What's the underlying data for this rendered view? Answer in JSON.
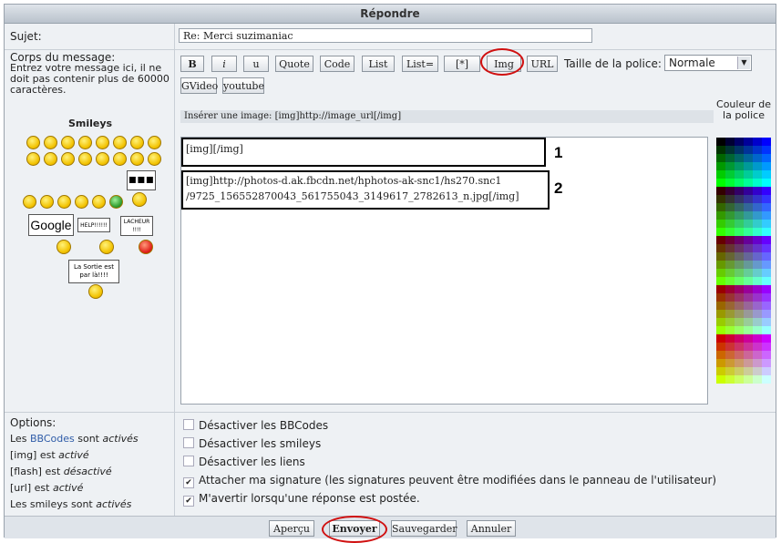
{
  "window": {
    "title": "Répondre"
  },
  "subject": {
    "label": "Sujet:",
    "value": "Re: Merci suzimaniac"
  },
  "message": {
    "label": "Corps du message:",
    "help": "Entrez votre message ici, il ne doit pas contenir plus de 60000 caractères."
  },
  "smileys": {
    "title": "Smileys",
    "signs": [
      "Google",
      "HELP!!!!!!",
      "LACHEUR !!!!",
      "La Sortie est par là!!!!"
    ]
  },
  "toolbar": {
    "buttons": [
      "B",
      "i",
      "u",
      "Quote",
      "Code",
      "List",
      "List=",
      "[*]",
      "Img",
      "URL"
    ],
    "row2": [
      "GVideo",
      "youtube"
    ],
    "font_size_label": "Taille de la police:",
    "font_size_value": "Normale"
  },
  "hint": "Insérer une image: [img]http://image_url[/img]",
  "editor": {
    "line1": "[img][/img]",
    "line2": "[img]http://photos-d.ak.fbcdn.net/hphotos-ak-snc1/hs270.snc1",
    "line3": "/9725_156552870043_561755043_3149617_2782613_n.jpg[/img]",
    "marker1": "1",
    "marker2": "2"
  },
  "colors": {
    "label": "Couleur de la police"
  },
  "options": {
    "label": "Options:",
    "status": [
      {
        "pre": "Les ",
        "link": "BBCodes",
        "mid": " sont ",
        "state": "activés"
      },
      {
        "pre": "[img] est ",
        "link": "",
        "mid": "",
        "state": "activé"
      },
      {
        "pre": "[flash] est ",
        "link": "",
        "mid": "",
        "state": "désactivé"
      },
      {
        "pre": "[url] est ",
        "link": "",
        "mid": "",
        "state": "activé"
      },
      {
        "pre": "Les smileys sont ",
        "link": "",
        "mid": "",
        "state": "activés"
      }
    ],
    "checkboxes": [
      {
        "label": "Désactiver les BBCodes",
        "checked": false
      },
      {
        "label": "Désactiver les smileys",
        "checked": false
      },
      {
        "label": "Désactiver les liens",
        "checked": false
      },
      {
        "label": "Attacher ma signature (les signatures peuvent être modifiées dans le panneau de l'utilisateur)",
        "checked": true
      },
      {
        "label": "M'avertir lorsqu'une réponse est postée.",
        "checked": true
      }
    ]
  },
  "actions": {
    "preview": "Aperçu",
    "send": "Envoyer",
    "save": "Sauvegarder",
    "cancel": "Annuler"
  },
  "accent": {
    "highlight": "#d01010"
  }
}
